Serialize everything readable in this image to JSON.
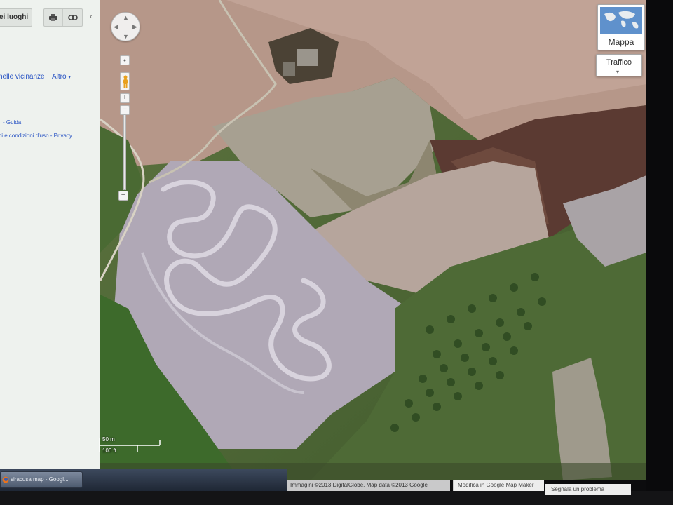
{
  "sidebar": {
    "places_label": "ei luoghi",
    "tools": [
      {
        "name": "print-icon"
      },
      {
        "name": "link-icon"
      }
    ],
    "collapse_icon": "chevron-left-icon",
    "nearby_label": "nelle vicinanze",
    "other_label": "Altro",
    "help_label": "- Guida",
    "terms_label": "ini e condizioni d'uso - Privacy"
  },
  "map": {
    "type_button_label": "Mappa",
    "traffic_button_label": "Traffico",
    "scale_metric": "50 m",
    "scale_imperial": "100 ft",
    "attribution": "Immagini ©2013 DigitalGlobe, Map data ©2013 Google",
    "mapmaker_link": "Modifica in Google Map Maker",
    "report_link": "Segnala un problema",
    "pan_icon": "pan-arrows-icon",
    "pegman_icon": "pegman-icon"
  },
  "taskbar": {
    "tab_label": "siracusa map - Googl..."
  },
  "colors": {
    "link_blue": "#2a55c4",
    "field_pink": "#b89a8e",
    "track_lilac": "#b5acc0",
    "olive_green": "#4f6b34"
  }
}
